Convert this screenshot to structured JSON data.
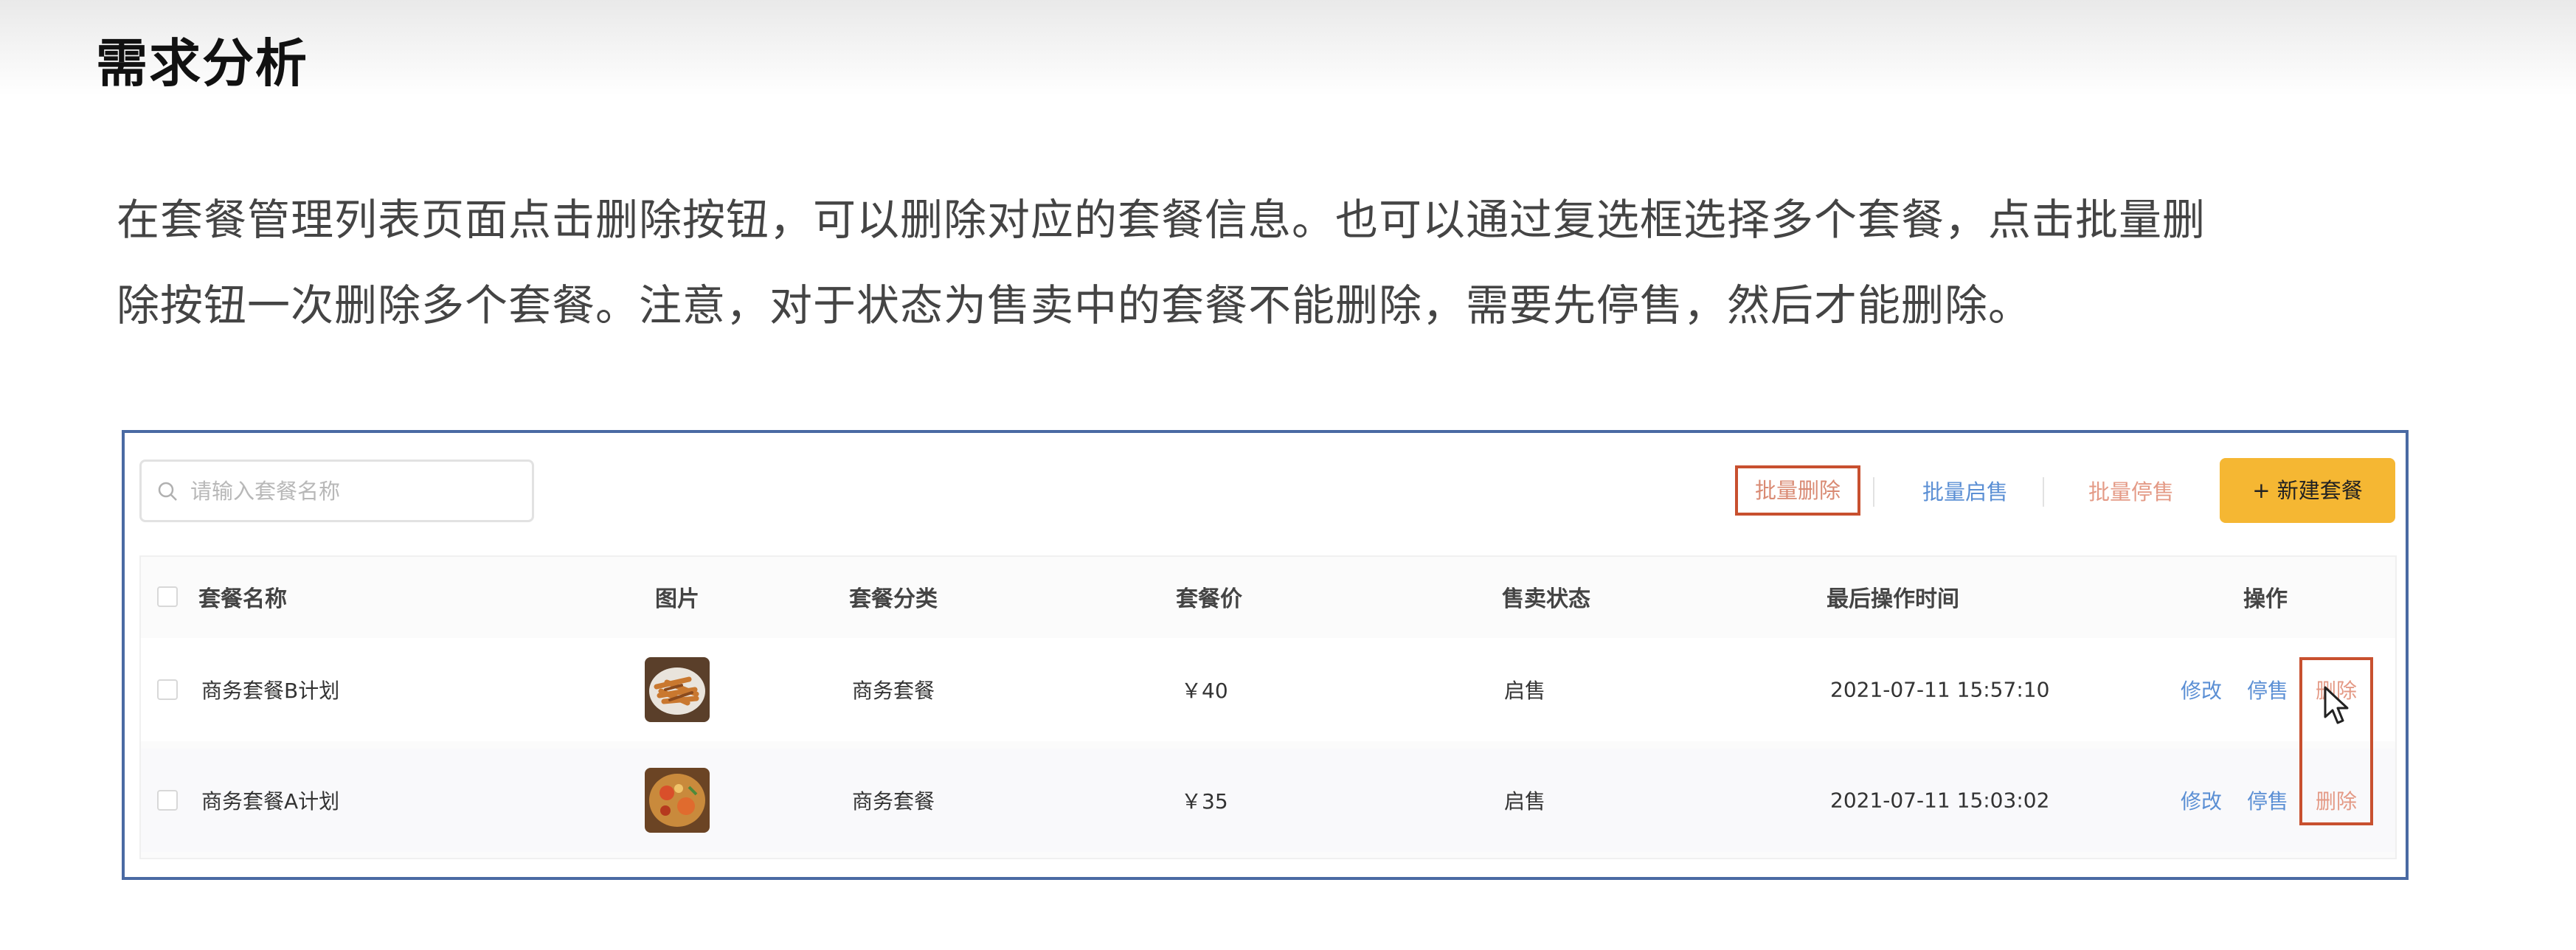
{
  "heading": "需求分析",
  "description": {
    "line1": "在套餐管理列表页面点击删除按钮，可以删除对应的套餐信息。也可以通过复选框选择多个套餐，点击批量删",
    "line2": "除按钮一次删除多个套餐。注意，对于状态为售卖中的套餐不能删除，需要先停售，然后才能删除。"
  },
  "toolbar": {
    "search_placeholder": "请输入套餐名称",
    "batch_delete": "批量删除",
    "batch_enable": "批量启售",
    "batch_disable": "批量停售",
    "new_combo": "+ 新建套餐"
  },
  "table": {
    "columns": [
      "套餐名称",
      "图片",
      "套餐分类",
      "套餐价",
      "售卖状态",
      "最后操作时间",
      "操作"
    ],
    "rows": [
      {
        "name": "商务套餐B计划",
        "category": "商务套餐",
        "price": "￥40",
        "status": "启售",
        "time": "2021-07-11 15:57:10",
        "edit": "修改",
        "toggle": "停售",
        "delete": "删除"
      },
      {
        "name": "商务套餐A计划",
        "category": "商务套餐",
        "price": "￥35",
        "status": "启售",
        "time": "2021-07-11 15:03:02",
        "edit": "修改",
        "toggle": "停售",
        "delete": "删除"
      }
    ]
  },
  "colors": {
    "accent_yellow": "#f5b733",
    "link_blue": "#5b8fd4",
    "danger_light": "#e49a86",
    "highlight_red": "#c8502f",
    "frame_blue": "#4a6aa3"
  },
  "icons": [
    "search-icon",
    "mouse-cursor-icon"
  ]
}
